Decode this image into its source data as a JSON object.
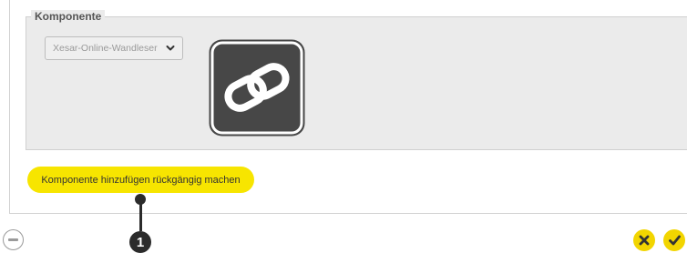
{
  "component_section": {
    "legend": "Komponente",
    "select": {
      "value": "Xesar-Online-Wandleser"
    }
  },
  "actions": {
    "undo_label": "Komponente hinzufügen rückgängig machen"
  },
  "callout": {
    "number": "1"
  },
  "icons": {
    "link": "link-icon",
    "remove": "minus-circle-icon",
    "cancel": "close-icon",
    "confirm": "check-icon"
  },
  "colors": {
    "accent_yellow": "#f7e500",
    "panel_gray": "#ebebeb",
    "icon_dark": "#474747"
  }
}
